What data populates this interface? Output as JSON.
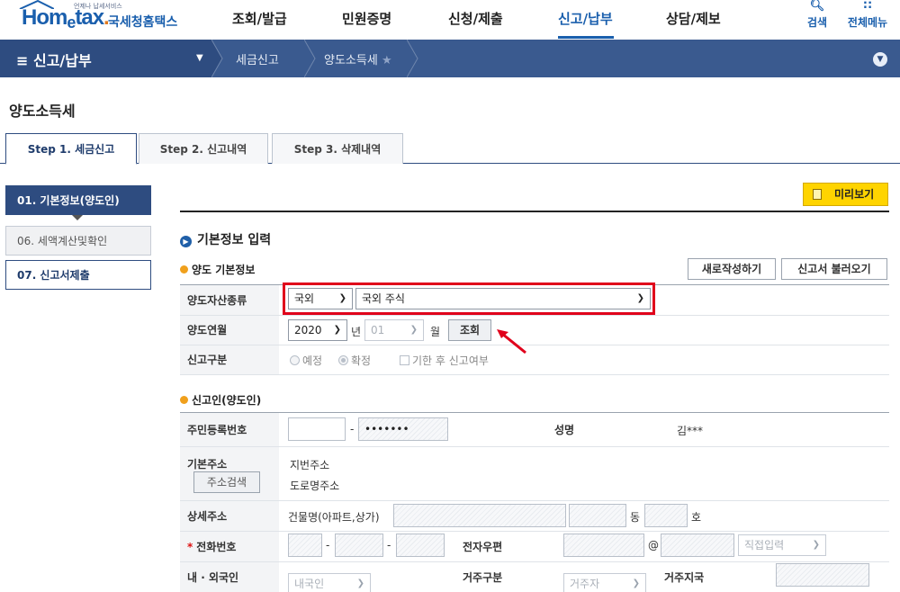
{
  "header": {
    "logo_tagline": "언제나 납세서비스",
    "logo_word_a": "Hom",
    "logo_word_e": "e",
    "logo_word_b": "tax",
    "logo_dot": ".",
    "logo_kr": "국세청홈택스",
    "gnb": [
      "조회/발급",
      "민원증명",
      "신청/제출",
      "신고/납부",
      "상담/제보"
    ],
    "active_gnb": "신고/납부",
    "search_label": "검색",
    "menu_label": "전체메뉴"
  },
  "navbar": {
    "menu_title": "≡  신고/납부",
    "crumbs": [
      "세금신고",
      "양도소득세"
    ],
    "star": "★"
  },
  "page_title": "양도소득세",
  "tabs": [
    "Step 1. 세금신고",
    "Step 2. 신고내역",
    "Step 3. 삭제내역"
  ],
  "side_menu": [
    "01. 기본정보(양도인)",
    "06. 세액계산및확인",
    "07. 신고서제출"
  ],
  "preview_label": "미리보기",
  "section_title": "기본정보 입력",
  "basic": {
    "title": "양도 기본정보",
    "new_button": "새로작성하기",
    "load_button": "신고서 불러오기",
    "asset_label": "양도자산종류",
    "asset_type": "국외",
    "asset_detail": "국외 주식",
    "month_label": "양도연월",
    "year": "2020",
    "year_unit": "년",
    "month": "01",
    "month_unit": "월",
    "lookup_button": "조회",
    "report_label": "신고구분",
    "opt_scheduled": "예정",
    "opt_final": "확정",
    "late_label": "기한 후 신고여부"
  },
  "reporter": {
    "title": "신고인(양도인)",
    "rrn_label": "주민등록번호",
    "rrn_dash": "-",
    "rrn_masked": "•••••••",
    "name_label": "성명",
    "name_value": "김***",
    "addr_label": "기본주소",
    "addr_search": "주소검색",
    "addr_jibun": "지번주소",
    "addr_road": "도로명주소",
    "detail_label": "상세주소",
    "building_label": "건물명(아파트,상가)",
    "dong": "동",
    "ho": "호",
    "phone_label": "전화번호",
    "phone_dash": "-",
    "email_label": "전자우편",
    "email_at": "@",
    "email_domain": "직접입력",
    "nationality_label": "내 · 외국인",
    "nationality_value": "내국인",
    "residence_label": "거주구분",
    "residence_value": "거주자",
    "country_label": "거주지국"
  }
}
